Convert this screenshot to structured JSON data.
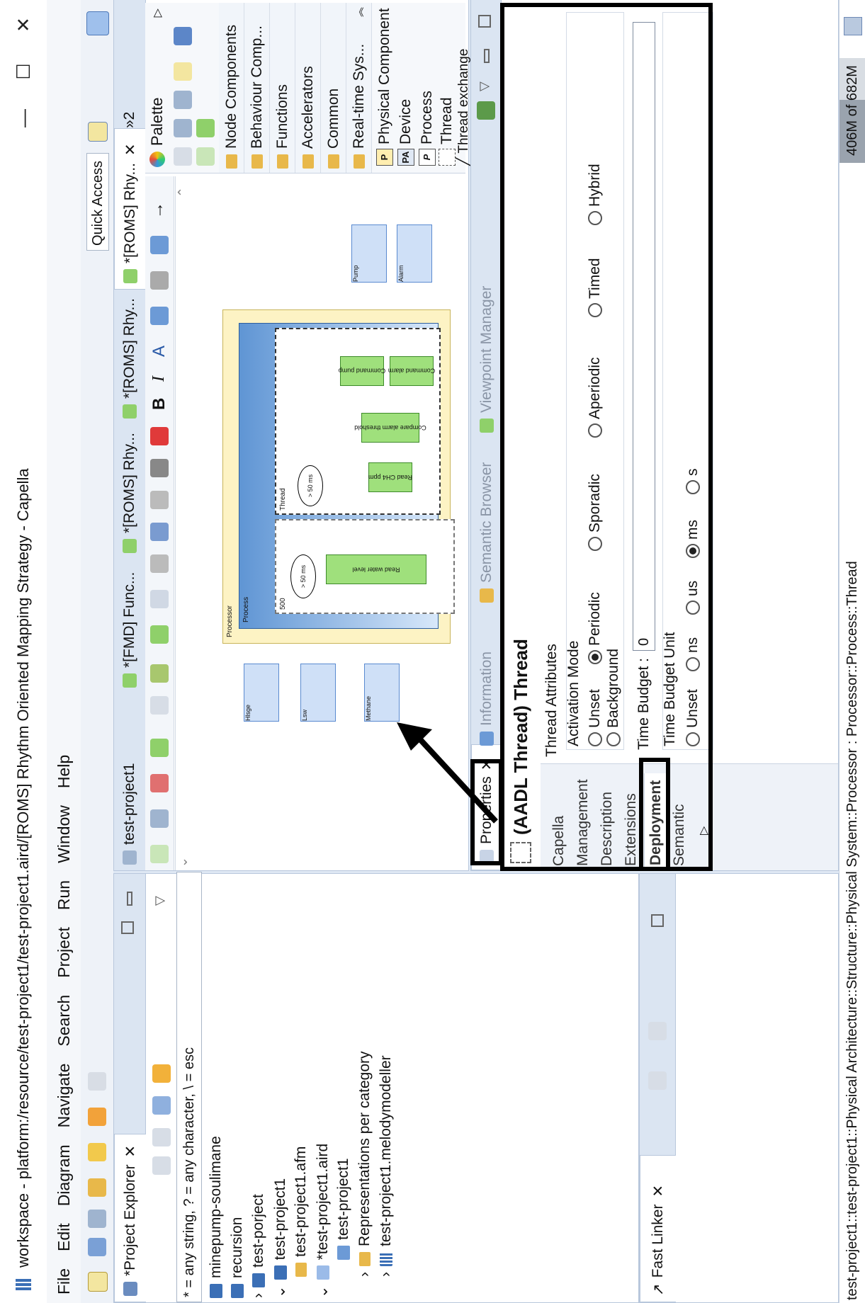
{
  "window": {
    "title": "workspace - platform:/resource/test-project1/test-project1.aird/[ROMS] Rhythm Oriented Mapping Strategy - Capella",
    "minimize": "—",
    "maximize": "☐",
    "close": "✕"
  },
  "menu": [
    "File",
    "Edit",
    "Diagram",
    "Navigate",
    "Search",
    "Project",
    "Run",
    "Window",
    "Help"
  ],
  "quick_access": "Quick Access",
  "project_explorer": {
    "tab_label": "*Project Explorer",
    "filter": "* = any string, ? = any character, \\ = esc",
    "items": [
      "minepump-soulimane",
      "recursion",
      "test-porject",
      "test-project1",
      "test-project1.afm",
      "*test-project1.aird",
      "test-project1",
      "Representations per category",
      "test-project1.melodymodeller"
    ]
  },
  "fast_linker": {
    "tab_label": "Fast Linker"
  },
  "editor_tabs": [
    "test-project1",
    "*[FMD] Func...",
    "*[ROMS] Rhy...",
    "*[ROMS] Rhy...",
    "*[ROMS] Rhy...",
    "»2"
  ],
  "palette": {
    "title": "Palette",
    "categories": [
      "Node Components",
      "Behaviour Comp...",
      "Functions",
      "Accelerators",
      "Common",
      "Real-time Sys..."
    ],
    "tools": [
      "Physical Component",
      "Device",
      "Process",
      "Thread",
      "Thread exchange"
    ],
    "tool_badges": [
      "P",
      "PA",
      "P",
      ""
    ]
  },
  "diagram": {
    "processor": "Processor",
    "process": "Process",
    "thread1": "500",
    "thread2": "Thread",
    "rate1": "> 50 ms",
    "rate2": "> 50 ms",
    "funcs": [
      "Read water level",
      "Read CH4 ppm",
      "Compare alarm threshold",
      "Command pump",
      "Command alarm"
    ],
    "externals": [
      "Hlsge",
      "Lsw",
      "Methane",
      "Pump",
      "Alarm"
    ]
  },
  "bottom_tabs": [
    "Properties",
    "Information",
    "Semantic Browser",
    "Viewpoint Manager"
  ],
  "properties": {
    "header": "(AADL Thread)  Thread",
    "side_tabs": [
      "Capella",
      "Management",
      "Description",
      "Extensions",
      "Deployment",
      "Semantic"
    ],
    "thread_attributes": "Thread Attributes",
    "activation_mode": "Activation Mode",
    "modes": [
      "Unset",
      "Periodic",
      "Sporadic",
      "Aperiodic",
      "Timed",
      "Hybrid",
      "Background"
    ],
    "selected_mode": "Periodic",
    "time_budget_label": "Time Budget :",
    "time_budget_value": "0",
    "time_budget_unit": "Time Budget Unit",
    "units": [
      "Unset",
      "ns",
      "us",
      "ms",
      "s"
    ],
    "selected_unit": "ms"
  },
  "status": {
    "path": "test-project1::test-project1::Physical Architecture::Structure::Physical System::Processor : Processor::Process::Thread",
    "memory": "406M of 682M"
  }
}
